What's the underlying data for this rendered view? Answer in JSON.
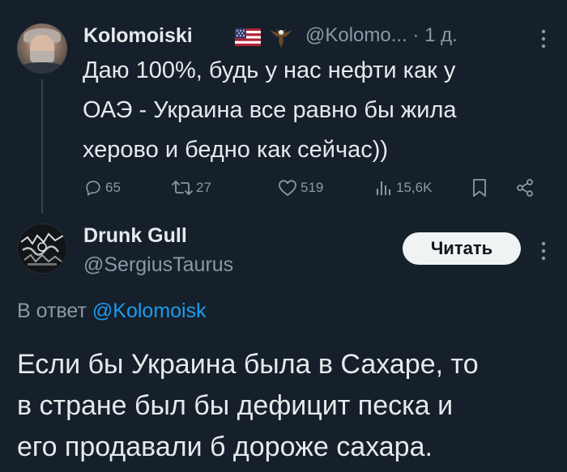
{
  "tweet": {
    "author_name": "Kolomoiski",
    "author_handle": "@Kolomo...",
    "separator": "·",
    "time": "1 д.",
    "text_lines": [
      "Даю 100%, будь у нас нефти как у",
      "ОАЭ - Украина все равно бы жила",
      "херово и бедно как сейчас))"
    ],
    "metrics": {
      "replies": "65",
      "retweets": "27",
      "likes": "519",
      "views": "15,6K"
    },
    "badges": [
      "us-flag-icon",
      "eagle-icon"
    ]
  },
  "reply": {
    "author_name": "Drunk Gull",
    "author_handle": "@SergiusTaurus",
    "follow_label": "Читать",
    "reply_prefix": "В ответ",
    "reply_mention": "@Kolomoisk",
    "text_lines": [
      "Если бы Украина была в Сахаре, то",
      "в стране был бы дефицит песка и",
      "его продавали б дороже сахара."
    ]
  },
  "colors": {
    "background": "#15202b",
    "primary_text": "#e7e9ea",
    "secondary_text": "#8b98a5",
    "accent_link": "#1d9bf0",
    "button_bg": "#eff3f4",
    "button_text": "#0f1419"
  }
}
